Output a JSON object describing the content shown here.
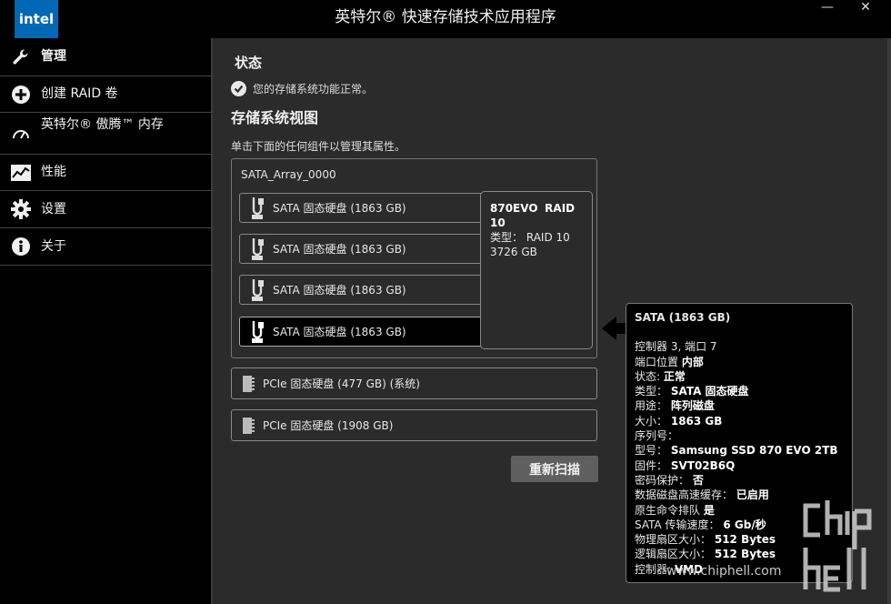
{
  "app": {
    "logo_text": "intel",
    "title": "英特尔® 快速存储技术应用程序",
    "brand_color": "#0068b5",
    "window_controls": {
      "minimize": "—",
      "close": "✕"
    }
  },
  "sidebar": {
    "items": [
      {
        "label": "管理",
        "icon": "wrench-icon",
        "active": true
      },
      {
        "label": "创建 RAID 卷",
        "icon": "plus-circle-icon"
      },
      {
        "label": "英特尔® 傲腾™ 内存",
        "icon": "gauge-icon"
      },
      {
        "label": "性能",
        "icon": "chart-icon"
      },
      {
        "label": "设置",
        "icon": "gear-icon"
      },
      {
        "label": "关于",
        "icon": "info-icon"
      }
    ]
  },
  "main": {
    "status_heading": "状态",
    "status_text": "您的存储系统功能正常。",
    "view_heading": "存储系统视图",
    "hint": "单击下面的任何组件以管理其属性。",
    "array": {
      "name": "SATA_Array_0000",
      "disks": [
        "SATA 固态硬盘 (1863 GB)",
        "SATA 固态硬盘 (1863 GB)",
        "SATA 固态硬盘 (1863 GB)",
        "SATA 固态硬盘 (1863 GB)"
      ],
      "volume_popup": {
        "name": "870EVO",
        "raid": "RAID 10",
        "type_label": "类型：",
        "type_value": "RAID 10",
        "size": "3726 GB"
      }
    },
    "pcie_disks": [
      "PCIe 固态硬盘 (477 GB) (系统)",
      "PCIe 固态硬盘 (1908 GB)"
    ],
    "rescan_button": "重新扫描"
  },
  "details": {
    "title": "SATA (1863 GB)",
    "rows": [
      {
        "label": "控制器 3, 端口 7",
        "value": ""
      },
      {
        "label": "端口位置",
        "value": "内部"
      },
      {
        "label": "状态:",
        "value": "正常"
      },
      {
        "label": "类型：",
        "value": "SATA 固态硬盘"
      },
      {
        "label": "用途：",
        "value": "阵列磁盘"
      },
      {
        "label": "大小：",
        "value": "1863 GB"
      },
      {
        "label": "序列号：",
        "value": ""
      },
      {
        "label": "型号：",
        "value": "Samsung SSD 870 EVO 2TB"
      },
      {
        "label": "固件：",
        "value": "SVT02B6Q"
      },
      {
        "label": "密码保护：",
        "value": "否"
      },
      {
        "label": "数据磁盘高速缓存：",
        "value": "已启用"
      },
      {
        "label": "原生命令排队",
        "value": "是"
      },
      {
        "label": "SATA 传输速度：",
        "value": "6 Gb/秒"
      },
      {
        "label": "物理扇区大小：",
        "value": "512 Bytes"
      },
      {
        "label": "逻辑扇区大小：",
        "value": "512 Bytes"
      },
      {
        "label": "控制器:",
        "value": "VMD"
      }
    ]
  },
  "watermark": {
    "site": "www.chiphell.com",
    "logo": "chip hell"
  }
}
